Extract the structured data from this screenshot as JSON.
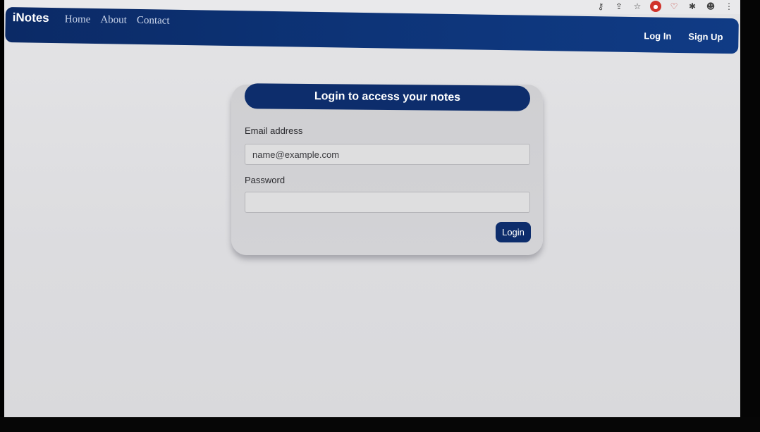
{
  "browser": {
    "toolbar_icons": [
      {
        "name": "key-icon",
        "glyph": "⚷"
      },
      {
        "name": "share-icon",
        "glyph": "⇪"
      },
      {
        "name": "bookmark-star-icon",
        "glyph": "☆"
      },
      {
        "name": "extension-badge-icon",
        "glyph": "●"
      },
      {
        "name": "shield-icon",
        "glyph": "♡"
      },
      {
        "name": "puzzle-extensions-icon",
        "glyph": "✱"
      },
      {
        "name": "profile-icon",
        "glyph": "☻"
      },
      {
        "name": "menu-kebab-icon",
        "glyph": "⋮"
      }
    ]
  },
  "navbar": {
    "brand": "iNotes",
    "links": [
      "Home",
      "About",
      "Contact"
    ],
    "login_label": "Log In",
    "signup_label": "Sign Up"
  },
  "login_card": {
    "header": "Login to access your notes",
    "email_label": "Email address",
    "email_placeholder": "name@example.com",
    "password_label": "Password",
    "password_placeholder": "",
    "submit_label": "Login"
  },
  "colors": {
    "navbar": "#0d3478",
    "accent": "#0d2d6c",
    "background": "#dcdcdf"
  }
}
